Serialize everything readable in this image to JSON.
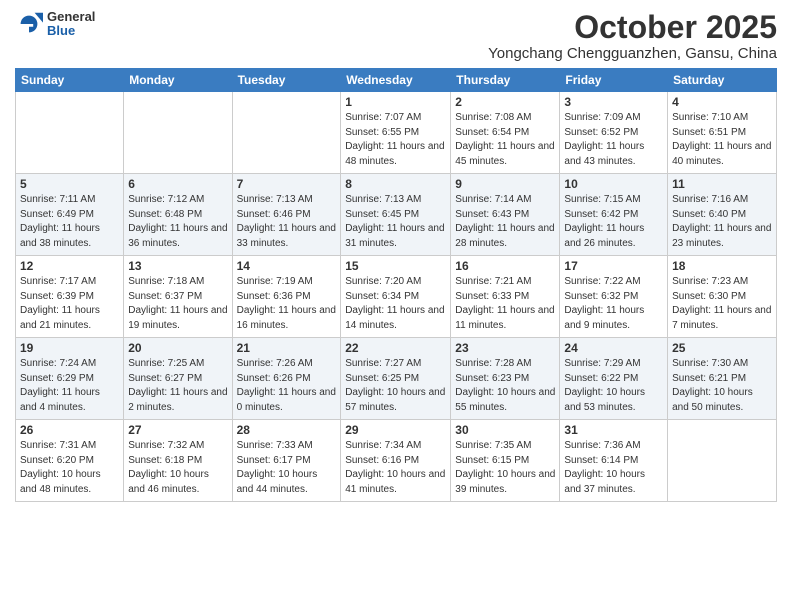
{
  "logo": {
    "general": "General",
    "blue": "Blue"
  },
  "title": "October 2025",
  "location": "Yongchang Chengguanzhen, Gansu, China",
  "days_header": [
    "Sunday",
    "Monday",
    "Tuesday",
    "Wednesday",
    "Thursday",
    "Friday",
    "Saturday"
  ],
  "weeks": [
    [
      {
        "day": "",
        "info": ""
      },
      {
        "day": "",
        "info": ""
      },
      {
        "day": "",
        "info": ""
      },
      {
        "day": "1",
        "info": "Sunrise: 7:07 AM\nSunset: 6:55 PM\nDaylight: 11 hours and 48 minutes."
      },
      {
        "day": "2",
        "info": "Sunrise: 7:08 AM\nSunset: 6:54 PM\nDaylight: 11 hours and 45 minutes."
      },
      {
        "day": "3",
        "info": "Sunrise: 7:09 AM\nSunset: 6:52 PM\nDaylight: 11 hours and 43 minutes."
      },
      {
        "day": "4",
        "info": "Sunrise: 7:10 AM\nSunset: 6:51 PM\nDaylight: 11 hours and 40 minutes."
      }
    ],
    [
      {
        "day": "5",
        "info": "Sunrise: 7:11 AM\nSunset: 6:49 PM\nDaylight: 11 hours and 38 minutes."
      },
      {
        "day": "6",
        "info": "Sunrise: 7:12 AM\nSunset: 6:48 PM\nDaylight: 11 hours and 36 minutes."
      },
      {
        "day": "7",
        "info": "Sunrise: 7:13 AM\nSunset: 6:46 PM\nDaylight: 11 hours and 33 minutes."
      },
      {
        "day": "8",
        "info": "Sunrise: 7:13 AM\nSunset: 6:45 PM\nDaylight: 11 hours and 31 minutes."
      },
      {
        "day": "9",
        "info": "Sunrise: 7:14 AM\nSunset: 6:43 PM\nDaylight: 11 hours and 28 minutes."
      },
      {
        "day": "10",
        "info": "Sunrise: 7:15 AM\nSunset: 6:42 PM\nDaylight: 11 hours and 26 minutes."
      },
      {
        "day": "11",
        "info": "Sunrise: 7:16 AM\nSunset: 6:40 PM\nDaylight: 11 hours and 23 minutes."
      }
    ],
    [
      {
        "day": "12",
        "info": "Sunrise: 7:17 AM\nSunset: 6:39 PM\nDaylight: 11 hours and 21 minutes."
      },
      {
        "day": "13",
        "info": "Sunrise: 7:18 AM\nSunset: 6:37 PM\nDaylight: 11 hours and 19 minutes."
      },
      {
        "day": "14",
        "info": "Sunrise: 7:19 AM\nSunset: 6:36 PM\nDaylight: 11 hours and 16 minutes."
      },
      {
        "day": "15",
        "info": "Sunrise: 7:20 AM\nSunset: 6:34 PM\nDaylight: 11 hours and 14 minutes."
      },
      {
        "day": "16",
        "info": "Sunrise: 7:21 AM\nSunset: 6:33 PM\nDaylight: 11 hours and 11 minutes."
      },
      {
        "day": "17",
        "info": "Sunrise: 7:22 AM\nSunset: 6:32 PM\nDaylight: 11 hours and 9 minutes."
      },
      {
        "day": "18",
        "info": "Sunrise: 7:23 AM\nSunset: 6:30 PM\nDaylight: 11 hours and 7 minutes."
      }
    ],
    [
      {
        "day": "19",
        "info": "Sunrise: 7:24 AM\nSunset: 6:29 PM\nDaylight: 11 hours and 4 minutes."
      },
      {
        "day": "20",
        "info": "Sunrise: 7:25 AM\nSunset: 6:27 PM\nDaylight: 11 hours and 2 minutes."
      },
      {
        "day": "21",
        "info": "Sunrise: 7:26 AM\nSunset: 6:26 PM\nDaylight: 11 hours and 0 minutes."
      },
      {
        "day": "22",
        "info": "Sunrise: 7:27 AM\nSunset: 6:25 PM\nDaylight: 10 hours and 57 minutes."
      },
      {
        "day": "23",
        "info": "Sunrise: 7:28 AM\nSunset: 6:23 PM\nDaylight: 10 hours and 55 minutes."
      },
      {
        "day": "24",
        "info": "Sunrise: 7:29 AM\nSunset: 6:22 PM\nDaylight: 10 hours and 53 minutes."
      },
      {
        "day": "25",
        "info": "Sunrise: 7:30 AM\nSunset: 6:21 PM\nDaylight: 10 hours and 50 minutes."
      }
    ],
    [
      {
        "day": "26",
        "info": "Sunrise: 7:31 AM\nSunset: 6:20 PM\nDaylight: 10 hours and 48 minutes."
      },
      {
        "day": "27",
        "info": "Sunrise: 7:32 AM\nSunset: 6:18 PM\nDaylight: 10 hours and 46 minutes."
      },
      {
        "day": "28",
        "info": "Sunrise: 7:33 AM\nSunset: 6:17 PM\nDaylight: 10 hours and 44 minutes."
      },
      {
        "day": "29",
        "info": "Sunrise: 7:34 AM\nSunset: 6:16 PM\nDaylight: 10 hours and 41 minutes."
      },
      {
        "day": "30",
        "info": "Sunrise: 7:35 AM\nSunset: 6:15 PM\nDaylight: 10 hours and 39 minutes."
      },
      {
        "day": "31",
        "info": "Sunrise: 7:36 AM\nSunset: 6:14 PM\nDaylight: 10 hours and 37 minutes."
      },
      {
        "day": "",
        "info": ""
      }
    ]
  ]
}
